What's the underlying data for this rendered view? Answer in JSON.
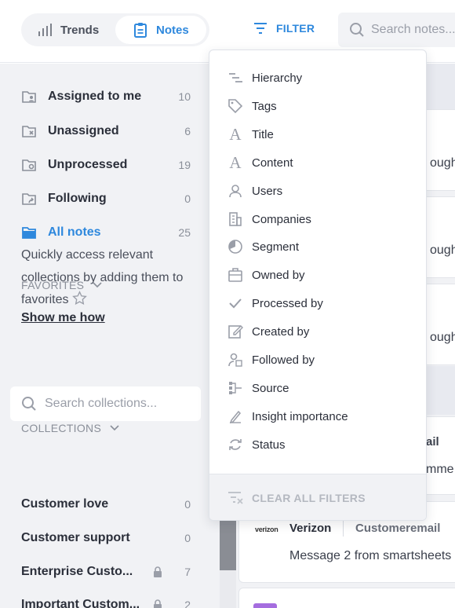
{
  "header": {
    "tabs": [
      {
        "label": "Trends",
        "icon": "bar-chart-icon",
        "active": false
      },
      {
        "label": "Notes",
        "icon": "clipboard-icon",
        "active": true
      }
    ],
    "filter_label": "FILTER",
    "search_placeholder": "Search notes..."
  },
  "sidebar": {
    "nav": [
      {
        "label": "Assigned to me",
        "count": "10",
        "icon": "folder-user-icon"
      },
      {
        "label": "Unassigned",
        "count": "6",
        "icon": "folder-x-icon"
      },
      {
        "label": "Unprocessed",
        "count": "19",
        "icon": "folder-circle-icon"
      },
      {
        "label": "Following",
        "count": "0",
        "icon": "folder-follow-icon"
      },
      {
        "label": "All notes",
        "count": "25",
        "icon": "folder-icon",
        "active": true
      }
    ],
    "favorites": {
      "heading": "FAVORITES",
      "text": "Quickly access relevant collections by adding them to favorites",
      "link": "Show me how"
    },
    "collections": {
      "heading": "COLLECTIONS",
      "search_placeholder": "Search collections...",
      "items": [
        {
          "label": "Customer love",
          "count": "0",
          "locked": false
        },
        {
          "label": "Customer support",
          "count": "0",
          "locked": false
        },
        {
          "label": "Enterprise Custo...",
          "count": "7",
          "locked": true
        },
        {
          "label": "Important Custom...",
          "count": "2",
          "locked": true
        }
      ]
    }
  },
  "main": {
    "partial_texts": [
      "ough Z",
      "ough Z",
      "ough Z",
      "ail",
      "mme"
    ],
    "card": {
      "logo": "verizon",
      "company": "Verizon",
      "source": "Customeremail",
      "message": "Message 2 from smartsheets"
    }
  },
  "filter_menu": {
    "items": [
      {
        "label": "Hierarchy",
        "icon": "hierarchy-icon"
      },
      {
        "label": "Tags",
        "icon": "tag-icon"
      },
      {
        "label": "Title",
        "icon": "text-a-icon"
      },
      {
        "label": "Content",
        "icon": "text-a-icon"
      },
      {
        "label": "Users",
        "icon": "user-icon"
      },
      {
        "label": "Companies",
        "icon": "building-icon"
      },
      {
        "label": "Segment",
        "icon": "pie-segment-icon"
      },
      {
        "label": "Owned by",
        "icon": "briefcase-icon"
      },
      {
        "label": "Processed by",
        "icon": "checkmark-icon"
      },
      {
        "label": "Created by",
        "icon": "edit-icon"
      },
      {
        "label": "Followed by",
        "icon": "followers-icon"
      },
      {
        "label": "Source",
        "icon": "source-icon"
      },
      {
        "label": "Insight importance",
        "icon": "pen-icon"
      },
      {
        "label": "Status",
        "icon": "refresh-icon"
      }
    ],
    "clear_label": "CLEAR ALL FILTERS"
  },
  "colors": {
    "accent": "#2e88dd",
    "sidebar_bg": "#f1f2f5",
    "muted": "#8a8f99"
  }
}
